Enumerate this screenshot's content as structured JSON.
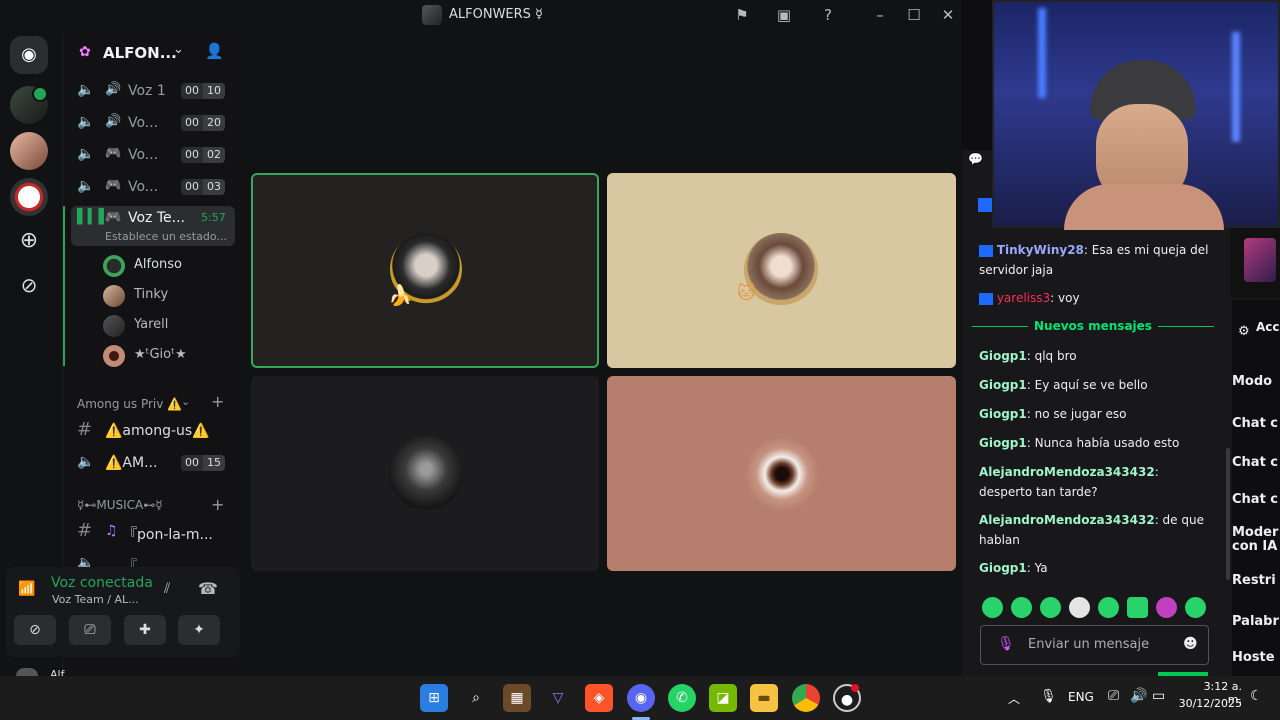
{
  "window": {
    "title": "ALFONWERS ☿"
  },
  "server": {
    "name": "ALFON..."
  },
  "voice_channels": [
    {
      "label": "Voz 1",
      "count_a": "00",
      "count_b": "10"
    },
    {
      "label": "Vo...",
      "count_a": "00",
      "count_b": "20"
    },
    {
      "label": "Vo...",
      "count_a": "00",
      "count_b": "02"
    },
    {
      "label": "Vo...",
      "count_a": "00",
      "count_b": "03"
    }
  ],
  "active_channel": {
    "label": "Voz Te...",
    "time": "5:57",
    "status": "Establece un estado..."
  },
  "members": [
    "Alfonso",
    "Tinky",
    "Yarell",
    "★ᵗGioᵗ★"
  ],
  "category_among": {
    "label": "Among us Priv ⚠️",
    "text_channel": "⚠️among-us⚠️",
    "voice_channel": "⚠️AM...",
    "count_a": "00",
    "count_b": "15"
  },
  "category_music": {
    "label": "☿⊷MUSICA⊷☿",
    "text_channel": "『pon-la-m...",
    "voice_channel": "『"
  },
  "voice_panel": {
    "status": "Voz conectada",
    "channel": "Voz Team / AL..."
  },
  "user_bar": {
    "name": "Alf..."
  },
  "chat": {
    "messages": [
      {
        "user": "TinkyWiny28",
        "color": "#9aa7ff",
        "text": ": Esa es mi queja del servidor jaja"
      },
      {
        "user": "yareliss3",
        "color": "#ff2a5a",
        "text": ": voy"
      },
      {
        "user": "Giogp1",
        "color": "#9ff4c9",
        "text": ": qlq bro"
      },
      {
        "user": "Giogp1",
        "color": "#9ff4c9",
        "text": ": Ey aquí se ve bello"
      },
      {
        "user": "Giogp1",
        "color": "#9ff4c9",
        "text": ": no se jugar eso"
      },
      {
        "user": "Giogp1",
        "color": "#9ff4c9",
        "text": ": Nunca había usado esto"
      },
      {
        "user": "AlejandroMendoza343432",
        "color": "#9ff4c9",
        "text": ": desperto tan tarde?"
      },
      {
        "user": "AlejandroMendoza343432",
        "color": "#9ff4c9",
        "text": ": de que hablan"
      },
      {
        "user": "Giogp1",
        "color": "#9ff4c9",
        "text": ": Ya"
      }
    ],
    "divider": "Nuevos mensajes",
    "placeholder": "Enviar un mensaje"
  },
  "side_menu": [
    "Acc car",
    "Modo",
    "Chat c",
    "Chat c",
    "Chat c",
    "Moder con IA",
    "Restri",
    "Palabr",
    "Hoste"
  ],
  "taskbar": {
    "lang": "ENG",
    "time": "3:12 a. m.",
    "date": "30/12/2025"
  },
  "colors": {
    "accent_green": "#23a55a",
    "twitch_purple": "#9147ff"
  }
}
